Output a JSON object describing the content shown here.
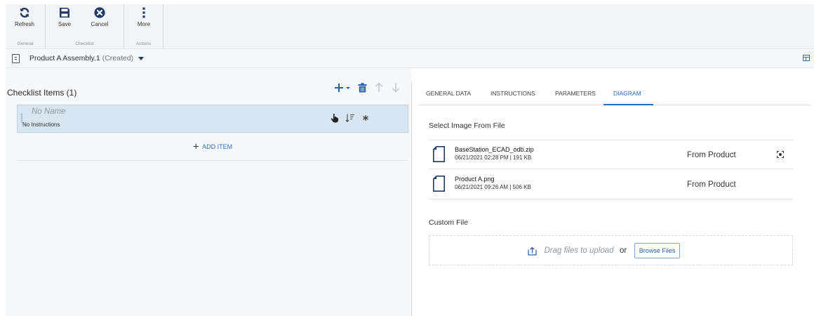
{
  "ribbon": {
    "groups": [
      {
        "name": "General",
        "buttons": [
          {
            "label": "Refresh",
            "icon": "refresh-icon"
          }
        ]
      },
      {
        "name": "Checklist",
        "buttons": [
          {
            "label": "Save",
            "icon": "save-icon"
          },
          {
            "label": "Cancel",
            "icon": "cancel-icon"
          }
        ]
      },
      {
        "name": "Actions",
        "buttons": [
          {
            "label": "More",
            "icon": "more-vertical-icon"
          }
        ]
      }
    ]
  },
  "title": {
    "name": "Product A Assembly.1",
    "status": "(Created)"
  },
  "checklist": {
    "header": "Checklist Items (1)",
    "items": [
      {
        "name": "No Name",
        "instructions": "No Instructions"
      }
    ],
    "add_plus": "+",
    "add_label": "ADD ITEM"
  },
  "tabs": [
    {
      "label": "GENERAL DATA"
    },
    {
      "label": "INSTRUCTIONS"
    },
    {
      "label": "PARAMETERS"
    },
    {
      "label": "DIAGRAM",
      "active": true
    }
  ],
  "diagram": {
    "select_title": "Select Image From File",
    "files": [
      {
        "name": "BaseStation_ECAD_odb.zip",
        "meta": "06/21/2021 02:28 PM | 191 KB",
        "source": "From Product"
      },
      {
        "name": "Product A.png",
        "meta": "06/21/2021 09:26 AM | 506 KB",
        "source": "From Product"
      }
    ],
    "custom_title": "Custom File",
    "drag_text": "Drag files to upload",
    "or_text": "or",
    "browse_label": "Browse Files"
  },
  "colors": {
    "accent": "#2c6fbe",
    "selected_row": "#d7e6f3",
    "icon_dark": "#1f3a66"
  }
}
